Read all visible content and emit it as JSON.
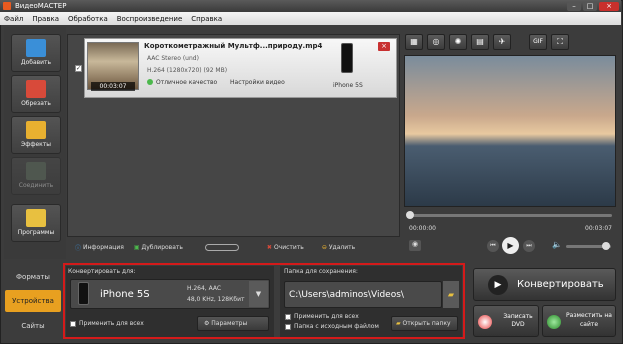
{
  "app": {
    "title": "ВидеоМАСТЕР"
  },
  "menu": [
    "Файл",
    "Правка",
    "Обработка",
    "Воспроизведение",
    "Справка"
  ],
  "sidebar": [
    {
      "label": "Добавить"
    },
    {
      "label": "Обрезать"
    },
    {
      "label": "Эффекты"
    },
    {
      "label": "Соединить"
    },
    {
      "label": "Программы"
    }
  ],
  "file": {
    "name": "Короткометражный Мультф...природу.mp4",
    "audio": "AAC Stereo (und)",
    "video": "H.264 (1280x720) (92 MB)",
    "quality": "Отличное качество",
    "settings": "Настройки видео",
    "duration": "00:03:07",
    "device": "iPhone 5S"
  },
  "filetoolbar": {
    "info": "Информация",
    "duplicate": "Дублировать",
    "clear": "Очистить",
    "delete": "Удалить"
  },
  "player": {
    "time_current": "00:00:00",
    "time_total": "00:03:07"
  },
  "tabs": [
    "Форматы",
    "Устройства",
    "Сайты"
  ],
  "convert": {
    "label": "Конвертировать для:",
    "device": "iPhone 5S",
    "codec": "H.264, AAC",
    "audio": "48,0 KHz, 128Кбит",
    "apply_all": "Применить для всех",
    "params": "Параметры"
  },
  "save": {
    "label": "Папка для сохранения:",
    "path": "C:\\Users\\adminos\\Videos\\",
    "apply_all": "Применить для всех",
    "source_folder": "Папка с исходным файлом",
    "open": "Открыть папку"
  },
  "actions": {
    "convert": "Конвертировать",
    "dvd": "Записать DVD",
    "publish": "Разместить на сайте"
  }
}
